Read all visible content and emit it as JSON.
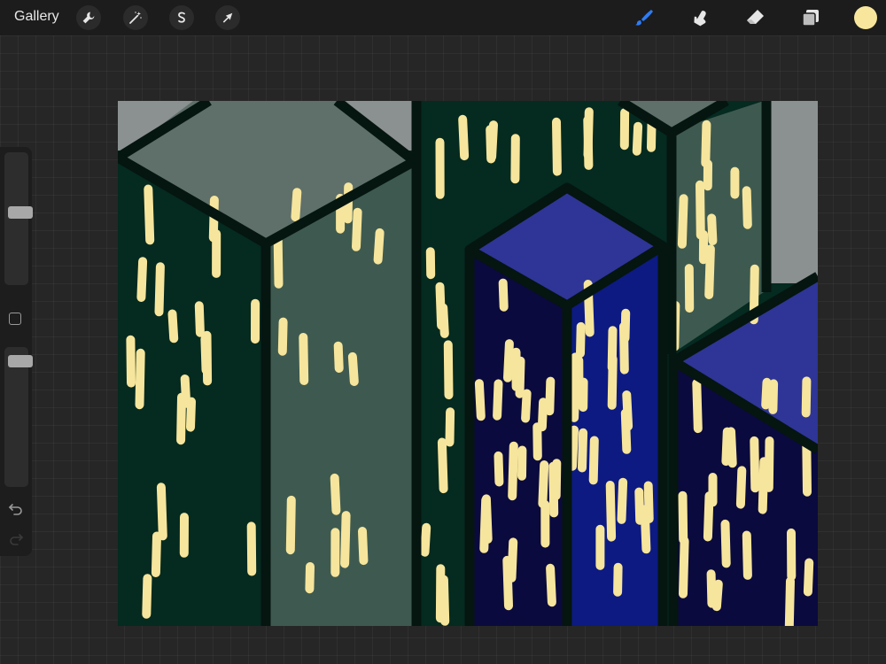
{
  "topbar": {
    "gallery_label": "Gallery",
    "actions": [
      {
        "name": "actions-wrench",
        "icon": "wrench-icon"
      },
      {
        "name": "adjustments",
        "icon": "magic-wand-icon"
      },
      {
        "name": "selection",
        "icon": "selection-s-icon"
      },
      {
        "name": "transform",
        "icon": "arrow-cursor-icon"
      }
    ],
    "tools": [
      {
        "name": "brush",
        "icon": "brush-icon",
        "active": true
      },
      {
        "name": "smudge",
        "icon": "smudge-finger-icon",
        "active": false
      },
      {
        "name": "eraser",
        "icon": "eraser-icon",
        "active": false
      },
      {
        "name": "layers",
        "icon": "layers-icon",
        "active": false
      }
    ],
    "current_color": "#f8e69c"
  },
  "sidebar": {
    "brush_size_level": 0.55,
    "opacity_level": 0.94,
    "modify_button_icon": "square-icon",
    "undo_icon": "undo-arrow-icon",
    "redo_icon": "redo-arrow-icon"
  },
  "artwork": {
    "description_colors": {
      "dark_green": "#052a20",
      "sage": "#3e5a50",
      "roof_gray": "#5f6f6a",
      "light_gray": "#8b9090",
      "window_yellow": "#f6e59c",
      "blue_roof": "#2e3596",
      "blue_face": "#0c1a82",
      "navy_face": "#0a0a3e",
      "outline": "#051510"
    }
  }
}
